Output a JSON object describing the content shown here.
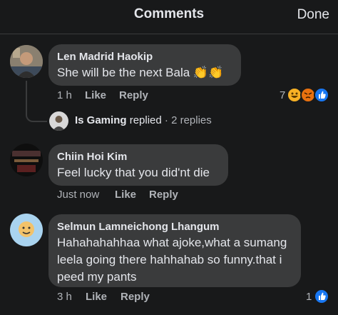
{
  "header": {
    "title": "Comments",
    "done_label": "Done"
  },
  "comments": [
    {
      "author": "Len Madrid Haokip",
      "text": "She will be the next Bala",
      "emojis": "👏👏",
      "time": "1 h",
      "like_label": "Like",
      "reply_label": "Reply",
      "reaction_count": "7",
      "reactions": [
        "haha",
        "angry",
        "like"
      ]
    },
    {
      "author": "Chiin Hoi Kim",
      "text": "Feel lucky that you did'nt die",
      "time": "Just now",
      "like_label": "Like",
      "reply_label": "Reply"
    },
    {
      "author": "Selmun Lamneichong Lhangum",
      "text_lines": [
        "Hahahahahhaa what ajoke,what a sumang",
        "leela going there hahhahab so funny.that i",
        "peed my pants"
      ],
      "time": "3 h",
      "like_label": "Like",
      "reply_label": "Reply",
      "reaction_count": "1",
      "reactions": [
        "like"
      ]
    }
  ],
  "reply_summary": {
    "name": "Is Gaming",
    "action": "replied",
    "count": "· 2 replies"
  },
  "colors": {
    "background": "#18191a",
    "bubble": "#3a3b3c",
    "text": "#e4e6eb",
    "secondary": "#b0b3b8",
    "like_blue": "#1877f2",
    "haha_yellow": "#f7b125",
    "angry_orange": "#e9710f"
  }
}
